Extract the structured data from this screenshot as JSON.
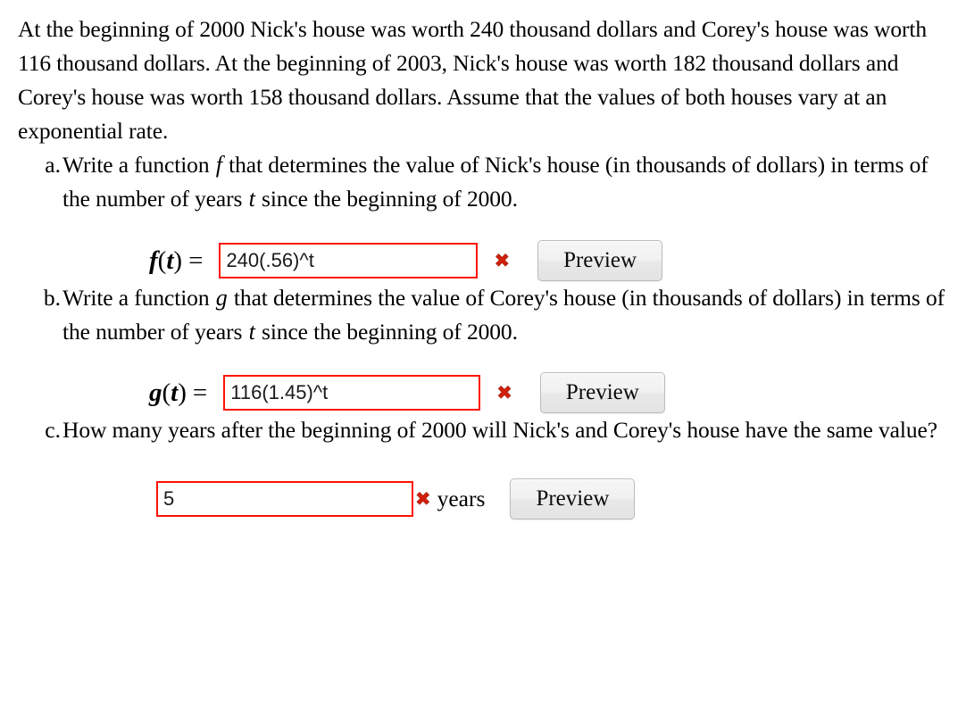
{
  "problem": {
    "intro": "At the beginning of 2000 Nick's house was worth 240 thousand dollars and Corey's house was worth 116 thousand dollars. At the beginning of 2003, Nick's house was worth 182 thousand dollars and Corey's house was worth 158 thousand dollars. Assume that the values of both houses vary at an exponential rate."
  },
  "parts": {
    "a": {
      "marker": "a.",
      "prompt_before_var": "Write a function ",
      "prompt_var": "f",
      "prompt_after_var": " that determines the value of Nick's house (in thousands of dollars) in terms of the number of years ",
      "prompt_var2": "t",
      "prompt_tail": " since the beginning of 2000.",
      "math_label_fn": "f",
      "math_label_arg": "t",
      "math_label_eq": "=",
      "input_value": "240(.56)^t",
      "input_placeholder": "",
      "status_icon": "incorrect-x-icon",
      "status_glyph": "✖",
      "preview_label": "Preview"
    },
    "b": {
      "marker": "b.",
      "prompt_before_var": "Write a function ",
      "prompt_var": "g",
      "prompt_after_var": " that determines the value of Corey's house (in thousands of dollars) in terms of the number of years ",
      "prompt_var2": "t",
      "prompt_tail": " since the beginning of 2000.",
      "math_label_fn": "g",
      "math_label_arg": "t",
      "math_label_eq": "=",
      "input_value": "116(1.45)^t",
      "input_placeholder": "",
      "status_icon": "incorrect-x-icon",
      "status_glyph": "✖",
      "preview_label": "Preview"
    },
    "c": {
      "marker": "c.",
      "prompt": "How many years after the beginning of 2000 will Nick's and Corey's house have the same value?",
      "input_value": "5",
      "input_placeholder": "",
      "status_icon": "incorrect-x-icon",
      "status_glyph": "✖",
      "unit_label": "years",
      "preview_label": "Preview"
    }
  },
  "colors": {
    "incorrect_border": "#ff1200",
    "incorrect_mark": "#d11f0c",
    "text": "#000000",
    "background": "#ffffff",
    "button_border": "#bbbbbb"
  }
}
